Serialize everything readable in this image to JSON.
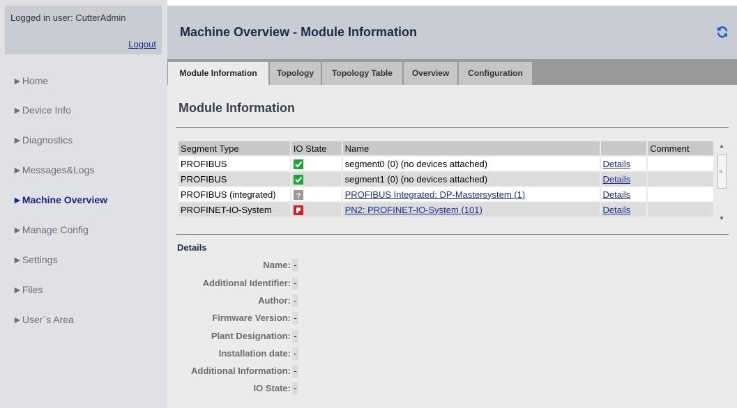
{
  "sidebar": {
    "logged_in_text": "Logged in user: CutterAdmin",
    "logout_label": "Logout",
    "items": [
      {
        "label": "►Home",
        "active": false
      },
      {
        "label": "►Device Info",
        "active": false
      },
      {
        "label": "►Diagnostics",
        "active": false
      },
      {
        "label": "►Messages&Logs",
        "active": false
      },
      {
        "label": "►Machine Overview",
        "active": true
      },
      {
        "label": "►Manage Config",
        "active": false
      },
      {
        "label": "►Settings",
        "active": false
      },
      {
        "label": "►Files",
        "active": false
      },
      {
        "label": "►User´s Area",
        "active": false
      }
    ]
  },
  "header": {
    "title": "Machine Overview - Module Information",
    "refresh_icon": "refresh-icon"
  },
  "tabs": [
    {
      "label": "Module Information",
      "active": true
    },
    {
      "label": "Topology",
      "active": false
    },
    {
      "label": "Topology Table",
      "active": false
    },
    {
      "label": "Overview",
      "active": false
    },
    {
      "label": "Configuration",
      "active": false
    }
  ],
  "section_title": "Module Information",
  "table": {
    "columns": [
      "Segment Type",
      "IO State",
      "Name",
      "",
      "Comment"
    ],
    "rows": [
      {
        "segment_type": "PROFIBUS",
        "io_state": "ok",
        "name": "segment0 (0) (no devices attached)",
        "name_is_link": false,
        "details": "Details",
        "comment": ""
      },
      {
        "segment_type": "PROFIBUS",
        "io_state": "ok",
        "name": "segment1 (0) (no devices attached)",
        "name_is_link": false,
        "details": "Details",
        "comment": ""
      },
      {
        "segment_type": "PROFIBUS (integrated)",
        "io_state": "unknown",
        "name": "PROFIBUS Integrated: DP-Mastersystem (1)",
        "name_is_link": true,
        "details": "Details",
        "comment": ""
      },
      {
        "segment_type": "PROFINET-IO-System",
        "io_state": "error",
        "name": "PN2: PROFINET-IO-System (101)",
        "name_is_link": true,
        "details": "Details",
        "comment": ""
      }
    ]
  },
  "details": {
    "title": "Details",
    "fields": [
      {
        "label": "Name:",
        "value": "-"
      },
      {
        "label": "Additional Identifier:",
        "value": "-"
      },
      {
        "label": "Author:",
        "value": "-"
      },
      {
        "label": "Firmware Version:",
        "value": "-"
      },
      {
        "label": "Plant Designation:",
        "value": "-"
      },
      {
        "label": "Installation date:",
        "value": "-"
      },
      {
        "label": "Additional Information:",
        "value": "-"
      },
      {
        "label": "IO State:",
        "value": "-"
      }
    ]
  },
  "colors": {
    "ok": "#1fa33a",
    "unknown": "#9a9a9a",
    "error": "#d42020",
    "accent": "#1a2d8c"
  }
}
